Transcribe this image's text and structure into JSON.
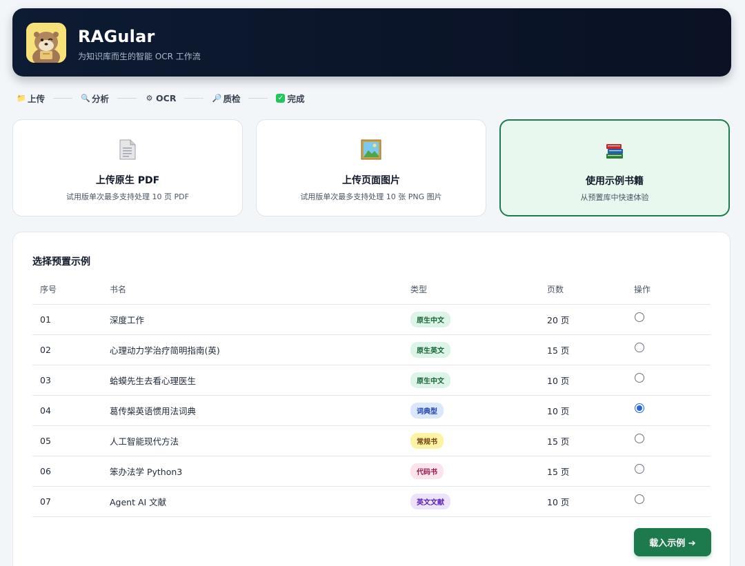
{
  "app": {
    "title": "RAGular",
    "subtitle": "为知识库而生的智能 OCR 工作流"
  },
  "steps": [
    {
      "icon": "📁",
      "label": "上传"
    },
    {
      "icon": "🔍",
      "label": "分析"
    },
    {
      "icon": "⚙",
      "label": "OCR"
    },
    {
      "icon": "🔎",
      "label": "质检"
    },
    {
      "icon": "✓",
      "label": "完成"
    }
  ],
  "options": [
    {
      "icon": "document-icon",
      "title": "上传原生 PDF",
      "desc": "试用版单次最多支持处理 10 页 PDF",
      "selected": false
    },
    {
      "icon": "picture-icon",
      "title": "上传页面图片",
      "desc": "试用版单次最多支持处理 10 张 PNG 图片",
      "selected": false
    },
    {
      "icon": "books-icon",
      "title": "使用示例书籍",
      "desc": "从预置库中快速体验",
      "selected": true
    }
  ],
  "examples": {
    "title": "选择预置示例",
    "headers": {
      "no": "序号",
      "name": "书名",
      "type": "类型",
      "pages": "页数",
      "action": "操作"
    },
    "rows": [
      {
        "no": "01",
        "name": "深度工作",
        "type": "原生中文",
        "pages": "20 页",
        "selected": false
      },
      {
        "no": "02",
        "name": "心理动力学治疗简明指南(英)",
        "type": "原生英文",
        "pages": "15 页",
        "selected": false
      },
      {
        "no": "03",
        "name": "蛤蟆先生去看心理医生",
        "type": "原生中文",
        "pages": "10 页",
        "selected": false
      },
      {
        "no": "04",
        "name": "葛传椝英语惯用法词典",
        "type": "词典型",
        "pages": "10 页",
        "selected": true
      },
      {
        "no": "05",
        "name": "人工智能现代方法",
        "type": "常规书",
        "pages": "15 页",
        "selected": false
      },
      {
        "no": "06",
        "name": "笨办法学 Python3",
        "type": "代码书",
        "pages": "15 页",
        "selected": false
      },
      {
        "no": "07",
        "name": "Agent AI 文献",
        "type": "英文文献",
        "pages": "10 页",
        "selected": false
      }
    ],
    "load_button": "载入示例 ➔"
  },
  "colors": {
    "accent": "#1d7a4c",
    "header_bg": "#0d1b33",
    "badge_green_bg": "#dcf5e8",
    "badge_green_fg": "#166534",
    "badge_blue_bg": "#dbe7fb",
    "badge_blue_fg": "#1e40af",
    "badge_yellow_bg": "#fdf3a4",
    "badge_yellow_fg": "#713f12",
    "badge_pink_bg": "#fce4ec",
    "badge_pink_fg": "#9d174d",
    "badge_purple_bg": "#ede4fb",
    "badge_purple_fg": "#5b21b6"
  }
}
